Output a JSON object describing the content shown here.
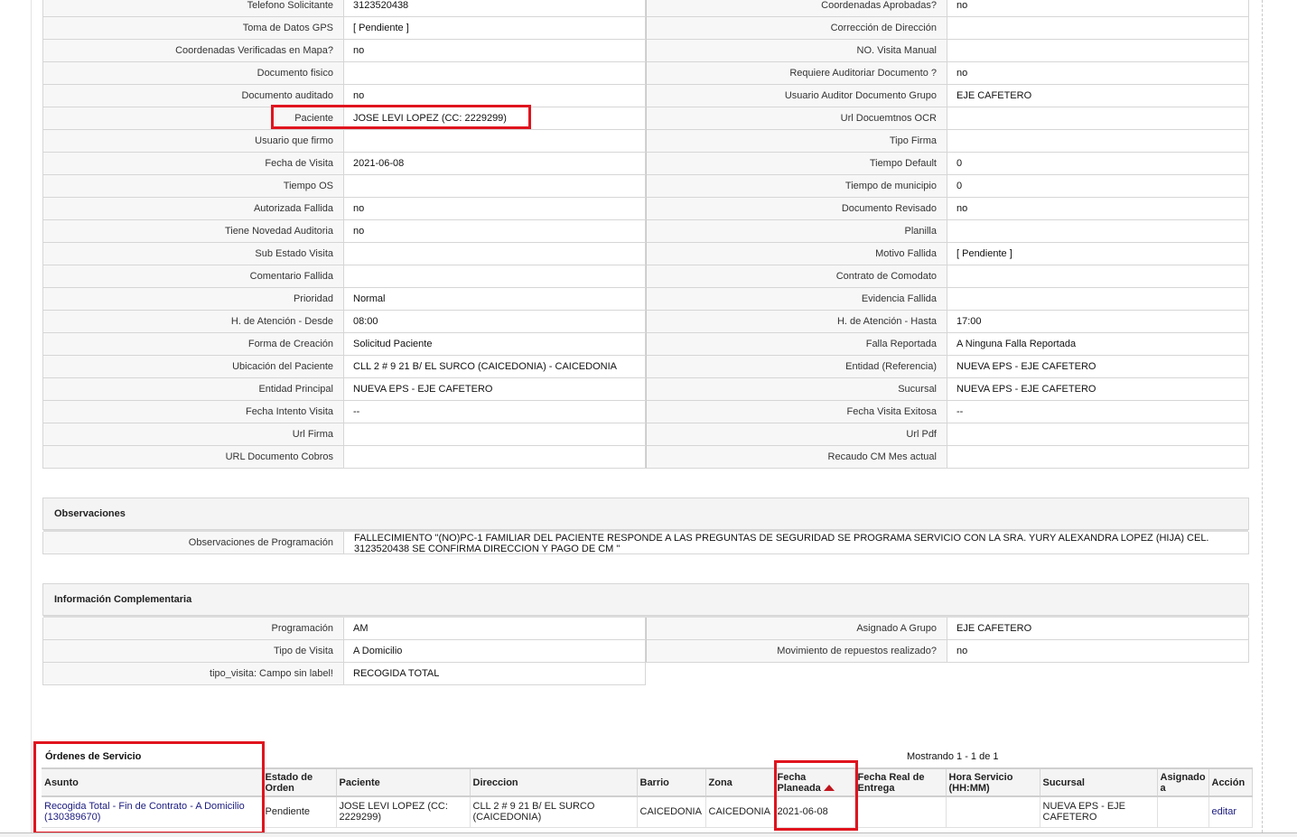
{
  "detail_rows": [
    {
      "l1": "Telefono Solicitante",
      "v1": "3123520438",
      "l2": "Coordenadas Aprobadas?",
      "v2": "no"
    },
    {
      "l1": "Toma de Datos GPS",
      "v1": "[ Pendiente ]",
      "l2": "Corrección de Dirección",
      "v2": ""
    },
    {
      "l1": "Coordenadas Verificadas en Mapa?",
      "v1": "no",
      "l2": "NO. Visita Manual",
      "v2": ""
    },
    {
      "l1": "Documento fisico",
      "v1": "",
      "l2": "Requiere Auditoriar Documento ?",
      "v2": "no"
    },
    {
      "l1": "Documento auditado",
      "v1": "no",
      "l2": "Usuario Auditor Documento Grupo",
      "v2": "EJE CAFETERO"
    },
    {
      "l1": "Paciente",
      "v1": "JOSE LEVI LOPEZ (CC: 2229299)",
      "l2": "Url Docuemtnos OCR",
      "v2": ""
    },
    {
      "l1": "Usuario que firmo",
      "v1": "",
      "l2": "Tipo Firma",
      "v2": ""
    },
    {
      "l1": "Fecha de Visita",
      "v1": "2021-06-08",
      "l2": "Tiempo Default",
      "v2": "0"
    },
    {
      "l1": "Tiempo OS",
      "v1": "",
      "l2": "Tiempo de municipio",
      "v2": "0"
    },
    {
      "l1": "Autorizada Fallida",
      "v1": "no",
      "l2": "Documento Revisado",
      "v2": "no"
    },
    {
      "l1": "Tiene Novedad Auditoria",
      "v1": "no",
      "l2": "Planilla",
      "v2": ""
    },
    {
      "l1": "Sub Estado Visita",
      "v1": "",
      "l2": "Motivo Fallida",
      "v2": "[ Pendiente ]"
    },
    {
      "l1": "Comentario Fallida",
      "v1": "",
      "l2": "Contrato de Comodato",
      "v2": ""
    },
    {
      "l1": "Prioridad",
      "v1": "Normal",
      "l2": "Evidencia Fallida",
      "v2": ""
    },
    {
      "l1": "H. de Atención - Desde",
      "v1": "08:00",
      "l2": "H. de Atención - Hasta",
      "v2": "17:00"
    },
    {
      "l1": "Forma de Creación",
      "v1": "Solicitud Paciente",
      "l2": "Falla Reportada",
      "v2": "A Ninguna Falla Reportada"
    },
    {
      "l1": "Ubicación del Paciente",
      "v1": "CLL 2 # 9 21 B/ EL SURCO (CAICEDONIA) - CAICEDONIA",
      "l2": "Entidad (Referencia)",
      "v2": "NUEVA EPS - EJE CAFETERO"
    },
    {
      "l1": "Entidad Principal",
      "v1": "NUEVA EPS - EJE CAFETERO",
      "l2": "Sucursal",
      "v2": "NUEVA EPS - EJE CAFETERO"
    },
    {
      "l1": "Fecha Intento Visita",
      "v1": "--",
      "l2": "Fecha Visita Exitosa",
      "v2": "--"
    },
    {
      "l1": "Url Firma",
      "v1": "",
      "l2": "Url Pdf",
      "v2": ""
    },
    {
      "l1": "URL Documento Cobros",
      "v1": "",
      "l2": "Recaudo CM Mes actual",
      "v2": ""
    }
  ],
  "observaciones": {
    "title": "Observaciones",
    "label": "Observaciones de Programación",
    "value": "FALLECIMIENTO \"(NO)PC-1 FAMILIAR DEL PACIENTE RESPONDE A LAS PREGUNTAS DE SEGURIDAD SE PROGRAMA SERVICIO CON LA SRA. YURY ALEXANDRA LOPEZ (HIJA) CEL. 3123520438 SE CONFIRMA DIRECCION Y PAGO DE CM \""
  },
  "complementaria": {
    "title": "Información Complementaria",
    "rows": [
      {
        "l1": "Programación",
        "v1": "AM",
        "l2": "Asignado A Grupo",
        "v2": "EJE CAFETERO"
      },
      {
        "l1": "Tipo de Visita",
        "v1": "A Domicilio",
        "l2": "Movimiento de repuestos realizado?",
        "v2": "no"
      }
    ],
    "last": {
      "l1": "tipo_visita: Campo sin label!",
      "v1": "RECOGIDA TOTAL"
    }
  },
  "orders": {
    "title": "Órdenes de Servicio",
    "mostrando": "Mostrando 1 - 1 de 1",
    "columns": [
      "Asunto",
      "Estado de Orden",
      "Paciente",
      "Direccion",
      "Barrio",
      "Zona",
      "Fecha Planeada",
      "Fecha Real de Entrega",
      "Hora Servicio (HH:MM)",
      "Sucursal",
      "Asignado a",
      "Acción"
    ],
    "sort_column": "Fecha Planeada",
    "sort_direction": "asc",
    "rows": [
      {
        "asunto": "Recogida Total - Fin de Contrato - A Domicilio (130389670)",
        "estado": "Pendiente",
        "paciente": "JOSE LEVI LOPEZ (CC: 2229299)",
        "direccion": "CLL 2 # 9 21 B/ EL SURCO (CAICEDONIA)",
        "barrio": "CAICEDONIA",
        "zona": "CAICEDONIA",
        "fecha_planeada": "2021-06-08",
        "fecha_real": "",
        "hora": "",
        "sucursal": "NUEVA EPS - EJE CAFETERO",
        "asignado": "",
        "accion": "editar"
      }
    ]
  },
  "colors": {
    "highlight": "#e0141e",
    "sort_arrow": "#c0161e",
    "link": "#1a1a80"
  }
}
